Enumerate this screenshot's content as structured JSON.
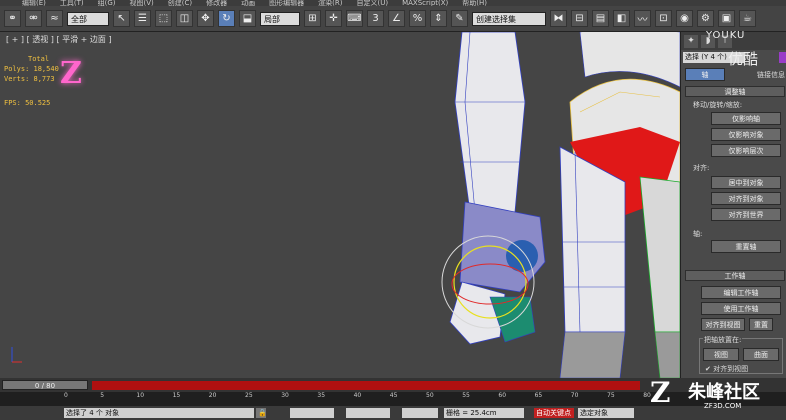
{
  "menu": [
    "编辑(E)",
    "工具(T)",
    "组(G)",
    "视图(V)",
    "创建(C)",
    "修改器",
    "动画",
    "图形编辑器",
    "渲染(R)",
    "自定义(U)",
    "MAXScript(X)",
    "帮助(H)"
  ],
  "toolbar": {
    "selection_filter": "全部",
    "ref_coord": "局部",
    "named_sel": "创建选择集"
  },
  "viewport": {
    "label": "[ + ] [ 透视 ] [ 平滑 + 边面 ]",
    "stats": {
      "title": "Total",
      "polys": "Polys: 18,540",
      "verts": "Verts: 8,773",
      "fps": "FPS:   50.525"
    }
  },
  "panel": {
    "object_name": "选择 (Y 4 个)",
    "youku": "YOUKU",
    "youku_cn": "优酷",
    "sub_label": "链接信息",
    "tab_pivot": "轴",
    "adjust_pivot_title": "调整轴",
    "move_rotate_scale": "移动/旋转/缩放:",
    "affect_pivot_only": "仅影响轴",
    "affect_object_only": "仅影响对象",
    "affect_hierarchy_only": "仅影响层次",
    "align_label": "对齐:",
    "center_to_object": "居中到对象",
    "align_to_object": "对齐到对象",
    "align_to_world": "对齐到世界",
    "pivot_label": "轴:",
    "reset_pivot": "重置轴",
    "working_pivot_title": "工作轴",
    "edit_working_pivot": "编辑工作轴",
    "use_working_pivot": "使用工作轴",
    "align_to_view": "对齐到视图",
    "reset": "重置",
    "place_pivot_label": "把轴放置在:",
    "view": "视图",
    "surface": "曲面",
    "align_to_view_check": "对齐到视图"
  },
  "timeline": {
    "slider": "0 / 80",
    "ticks": [
      "0",
      "5",
      "10",
      "15",
      "20",
      "25",
      "30",
      "35",
      "40",
      "45",
      "50",
      "55",
      "60",
      "65",
      "70",
      "75",
      "80"
    ]
  },
  "status": {
    "selected": "选择了 4 个 对象",
    "grid": "栅格 = 25.4cm",
    "autokey": "自动关键点",
    "selected_obj": "选定对象"
  },
  "watermark": {
    "main": "朱峰社区",
    "sub": "ZF3D.COM"
  }
}
